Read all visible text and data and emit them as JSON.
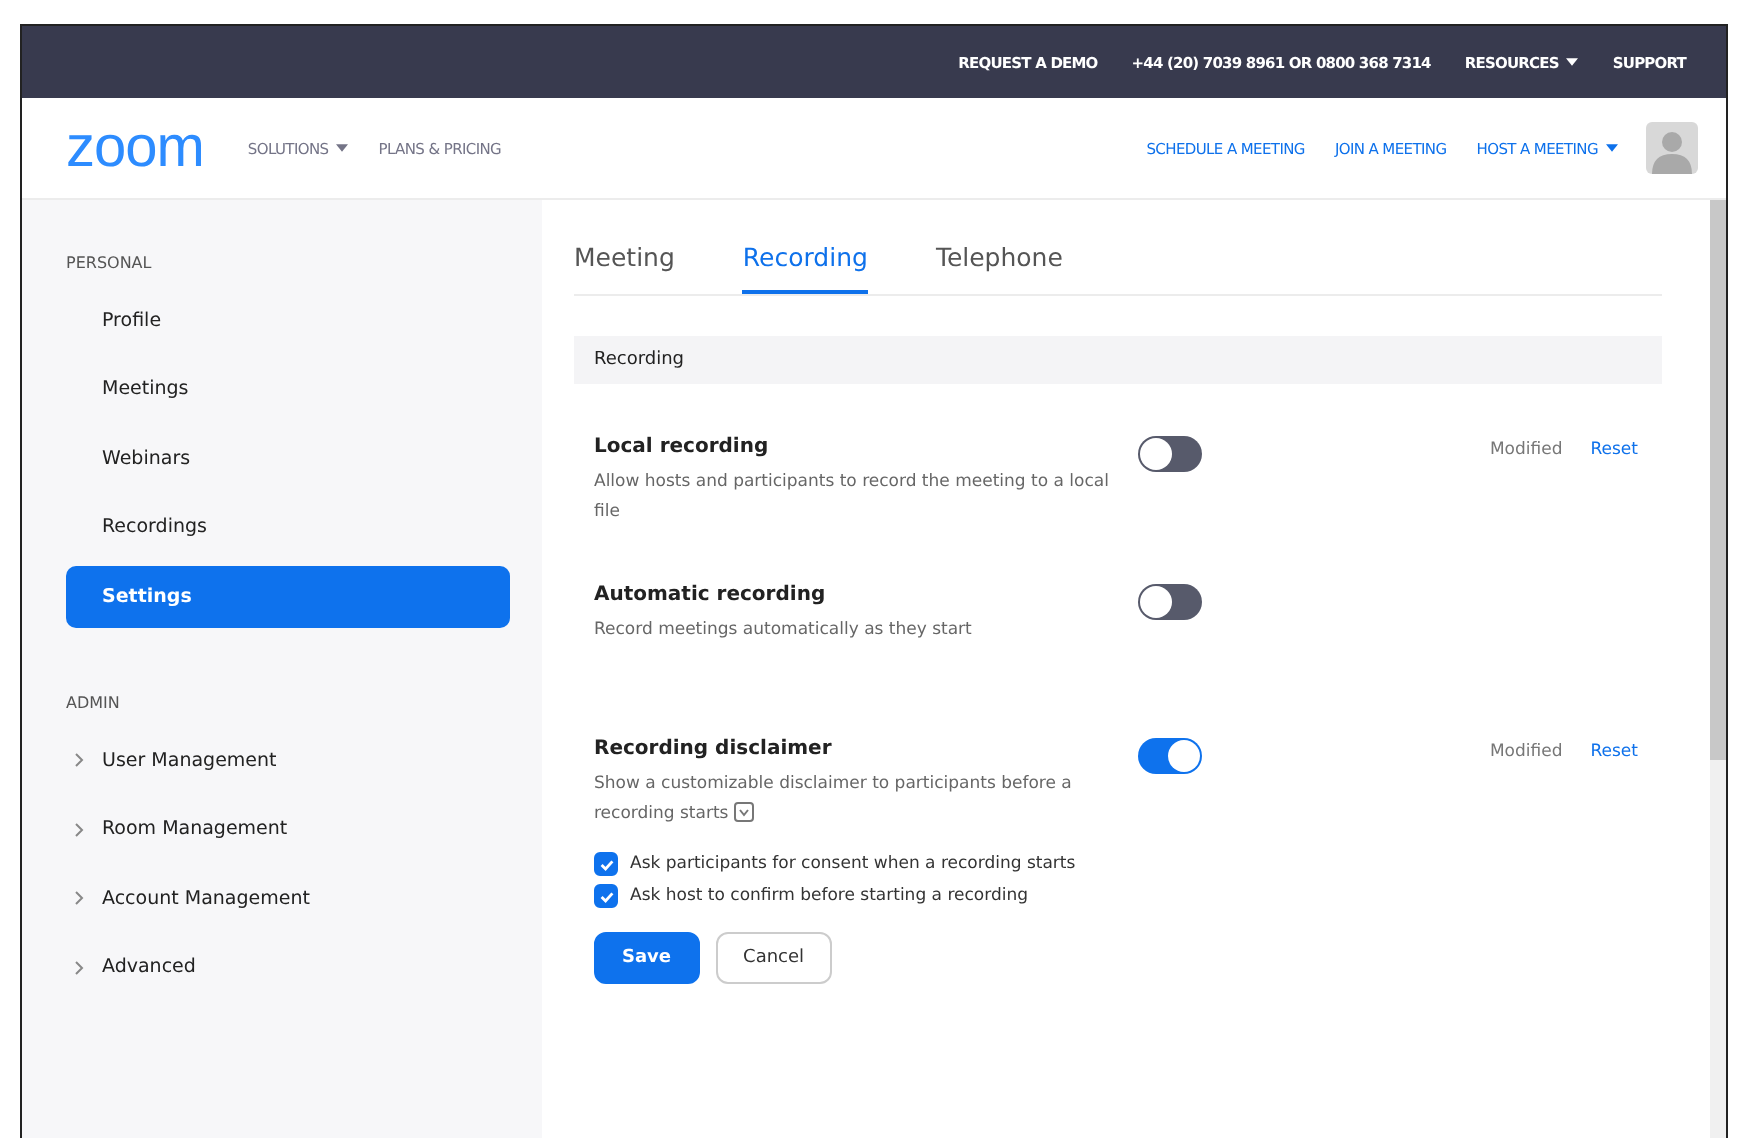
{
  "top_bar": {
    "links": [
      {
        "label": "REQUEST A DEMO",
        "has_caret": false
      },
      {
        "label": "+44 (20) 7039 8961 OR 0800 368 7314",
        "has_caret": false
      },
      {
        "label": "RESOURCES",
        "has_caret": true
      },
      {
        "label": "SUPPORT",
        "has_caret": false
      }
    ]
  },
  "header": {
    "logo": "zoom",
    "nav_left": [
      {
        "label": "SOLUTIONS",
        "has_caret": true
      },
      {
        "label": "PLANS & PRICING",
        "has_caret": false
      }
    ],
    "nav_right": [
      {
        "label": "SCHEDULE A MEETING",
        "has_caret": false
      },
      {
        "label": "JOIN A MEETING",
        "has_caret": false
      },
      {
        "label": "HOST A MEETING",
        "has_caret": true
      }
    ]
  },
  "sidebar": {
    "sections": [
      {
        "title": "PERSONAL",
        "items": [
          {
            "label": "Profile",
            "selected": false
          },
          {
            "label": "Meetings",
            "selected": false
          },
          {
            "label": "Webinars",
            "selected": false
          },
          {
            "label": "Recordings",
            "selected": false
          },
          {
            "label": "Settings",
            "selected": true
          }
        ]
      },
      {
        "title": "ADMIN",
        "items": [
          {
            "label": "User Management",
            "selected": false,
            "expanded": false
          },
          {
            "label": "Room Management",
            "selected": false,
            "expanded": false
          },
          {
            "label": "Account Management",
            "selected": false,
            "expanded": false
          },
          {
            "label": "Advanced",
            "selected": false,
            "expanded": false
          }
        ]
      }
    ]
  },
  "tabs": [
    {
      "label": "Meeting",
      "selected": false
    },
    {
      "label": "Recording",
      "selected": true
    },
    {
      "label": "Telephone",
      "selected": false
    }
  ],
  "section_title": "Recording",
  "settings": [
    {
      "title": "Local recording",
      "description": "Allow hosts and participants to record the meeting to a local file",
      "on": false,
      "status": "Modified",
      "action": "Reset"
    },
    {
      "title": "Automatic recording",
      "description": "Record meetings automatically as they start",
      "on": false
    },
    {
      "title": "Recording disclaimer",
      "description": "Show a customizable disclaimer to participants before a recording starts",
      "has_expand_icon": true,
      "on": true,
      "status": "Modified",
      "action": "Reset",
      "options": [
        {
          "label": "Ask participants for consent when a recording starts",
          "checked": true
        },
        {
          "label": "Ask host to confirm before starting a recording",
          "checked": true
        }
      ],
      "buttons": [
        {
          "label": "Save",
          "kind": "primary"
        },
        {
          "label": "Cancel",
          "kind": "secondary"
        }
      ]
    }
  ]
}
